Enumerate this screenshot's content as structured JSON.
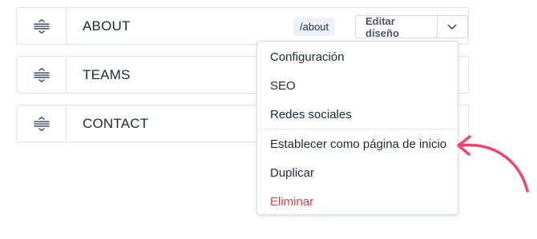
{
  "pages": [
    {
      "title": "ABOUT",
      "slug": "/about",
      "edit_label": "Editar diseño"
    },
    {
      "title": "TEAMS"
    },
    {
      "title": "CONTACT"
    }
  ],
  "menu": {
    "items": [
      {
        "label": "Configuración"
      },
      {
        "label": "SEO"
      },
      {
        "label": "Redes sociales"
      },
      {
        "label": "Establecer como página de inicio"
      },
      {
        "label": "Duplicar"
      },
      {
        "label": "Eliminar"
      }
    ]
  },
  "colors": {
    "danger": "#d64545",
    "annotation_arrow": "#f0466e",
    "badge_bg": "#eef1f7",
    "border": "#dde2e8"
  },
  "icons": {
    "drag_handle": "drag-handle-icon",
    "chevron": "chevron-down-icon",
    "annotation": "curved-arrow-icon"
  }
}
